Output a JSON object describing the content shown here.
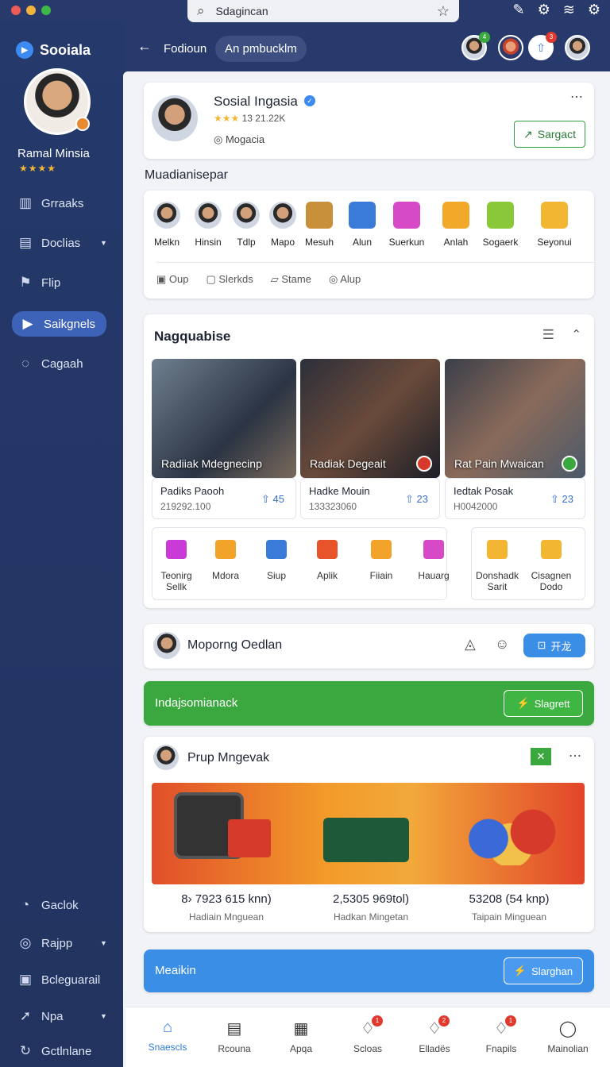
{
  "search": {
    "value": "Sdagincan"
  },
  "sidebar": {
    "brand": "Sooiala",
    "user_name": "Ramal Minsia",
    "rating": "★★★★",
    "items": [
      {
        "label": "Grraaks",
        "icon": "chart-icon"
      },
      {
        "label": "Doclias",
        "icon": "building-icon"
      },
      {
        "label": "Flip",
        "icon": "flag-icon"
      },
      {
        "label": "Saikgnels",
        "icon": "play-icon"
      },
      {
        "label": "Cagaah",
        "icon": "chat-icon"
      },
      {
        "label": "Gaclok",
        "icon": "compass-icon"
      },
      {
        "label": "Rajpp",
        "icon": "settings-icon"
      },
      {
        "label": "Bcleguarail",
        "icon": "box-icon"
      },
      {
        "label": "Npa",
        "icon": "send-icon"
      },
      {
        "label": "Gctlnlane",
        "icon": "refresh-icon"
      }
    ]
  },
  "header": {
    "back": "←",
    "crumb": "Fodioun",
    "pill": "An pmbucklm",
    "badges": [
      "4",
      "3"
    ]
  },
  "profile": {
    "name": "Sosial Ingasia",
    "stats": "13 21.22K",
    "location": "Mogacia",
    "action": "Sargact",
    "stars": "★★★"
  },
  "friends_title": "Muadianisepar",
  "friends": [
    {
      "label": "Melkn"
    },
    {
      "label": "Hinsin"
    },
    {
      "label": "Tdlp"
    },
    {
      "label": "Mapo"
    },
    {
      "label": "Mesuh"
    },
    {
      "label": "Alun"
    },
    {
      "label": "Suerkun"
    },
    {
      "label": "Anlah"
    },
    {
      "label": "Sogaerk"
    },
    {
      "label": "Seyonui"
    }
  ],
  "friend_actions": [
    {
      "label": "Oup"
    },
    {
      "label": "Slerkds"
    },
    {
      "label": "Stame"
    },
    {
      "label": "Alup"
    }
  ],
  "feed": {
    "title": "Nagquabise",
    "photos": [
      {
        "caption": "Radiiak Mdegnecinp",
        "name": "Padiks Paooh",
        "num": "219292.100",
        "count": "45"
      },
      {
        "caption": "Radiak Degeait",
        "name": "Hadke Mouin",
        "num": "133323060",
        "count": "23"
      },
      {
        "caption": "Rat Pain Mwaican",
        "name": "Iedtak Posak",
        "num": "H0042000",
        "count": "23"
      }
    ],
    "gifts": [
      {
        "label": "Teonirg\nSellk"
      },
      {
        "label": "Mdora"
      },
      {
        "label": "Siup"
      },
      {
        "label": "Aplik"
      },
      {
        "label": "Fiiain"
      },
      {
        "label": "Hauarg"
      },
      {
        "label": "Donshadk\nSarit"
      },
      {
        "label": "Cisagnen\nDodo"
      }
    ]
  },
  "story": {
    "name": "Moporng Oedlan",
    "button": "开龙"
  },
  "banner1": {
    "text": "Indajsomianack",
    "button": "Slagrett"
  },
  "post": {
    "name": "Prup Mngevak",
    "items": [
      {
        "price": "8› 7923 615 knn)",
        "sub": "Hadiain Mnguean"
      },
      {
        "price": "2,5305 969tol)",
        "sub": "Hadkan Mingetan"
      },
      {
        "price": "53208 (54 knp)",
        "sub": "Taipain Minguean"
      }
    ]
  },
  "banner2": {
    "text": "Meaikin",
    "button": "Slarghan"
  },
  "bottom_nav": [
    {
      "label": "Snaescls",
      "icon": "home-icon"
    },
    {
      "label": "Rcouna",
      "icon": "list-icon"
    },
    {
      "label": "Apqa",
      "icon": "grid-icon"
    },
    {
      "label": "Scloas",
      "icon": "bell-icon",
      "badge": "1"
    },
    {
      "label": "Elladës",
      "icon": "bell-icon",
      "badge": "2"
    },
    {
      "label": "Fnapils",
      "icon": "bell-icon",
      "badge": "1"
    },
    {
      "label": "Mainolian",
      "icon": "user-icon"
    }
  ],
  "colors": {
    "sidebar": "#25396b",
    "accent": "#3d8bf2",
    "green": "#3aa83e",
    "blue": "#3b8ee6"
  }
}
